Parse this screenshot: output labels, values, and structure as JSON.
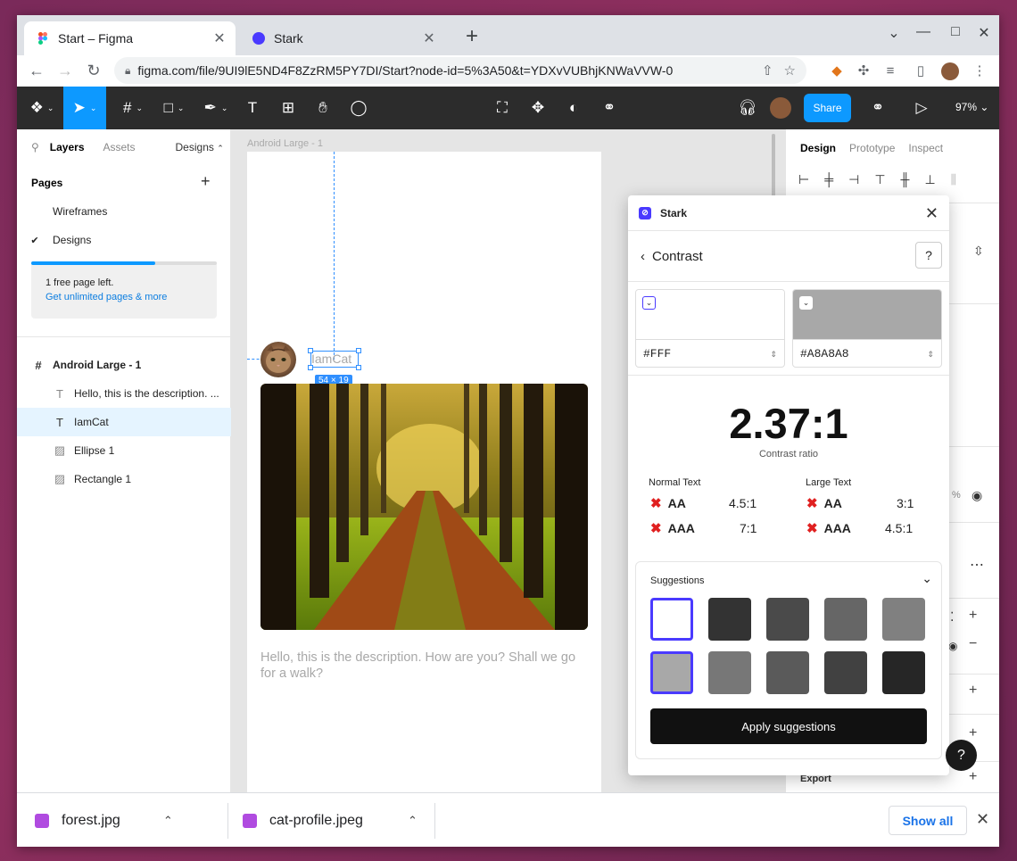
{
  "browser": {
    "tabs": [
      {
        "title": "Start – Figma",
        "active": true
      },
      {
        "title": "Stark",
        "active": false
      }
    ],
    "url": "figma.com/file/9UI9lE5ND4F8ZzRM5PY7DI/Start?node-id=5%3A50&t=YDXvVUBhjKNWaVVW-0"
  },
  "toolbar": {
    "share_label": "Share",
    "zoom_label": "97%"
  },
  "left_panel": {
    "tabs": [
      "Layers",
      "Assets"
    ],
    "page_dropdown": "Designs",
    "pages_heading": "Pages",
    "pages": [
      {
        "label": "Wireframes",
        "checked": false
      },
      {
        "label": "Designs",
        "checked": true
      }
    ],
    "upsell": {
      "text": "1 free page left.",
      "link": "Get unlimited pages & more",
      "progress": 0.67
    },
    "layers": [
      {
        "label": "Android Large - 1",
        "icon": "frame-icon",
        "bold": true
      },
      {
        "label": "Hello, this is the description. ...",
        "icon": "text-icon"
      },
      {
        "label": "IamCat",
        "icon": "text-icon",
        "selected": true
      },
      {
        "label": "Ellipse 1",
        "icon": "image-icon"
      },
      {
        "label": "Rectangle 1",
        "icon": "image-icon"
      }
    ]
  },
  "canvas": {
    "frame_label": "Android Large - 1",
    "selected_text": "IamCat",
    "dimension_badge": "54 × 19",
    "description": "Hello, this is the description. How are you? Shall we go for a walk?"
  },
  "right_panel": {
    "tabs": [
      "Design",
      "Prototype",
      "Inspect"
    ],
    "percent_fragment": "%",
    "export_label": "Export"
  },
  "stark": {
    "title": "Stark",
    "subtitle": "Contrast",
    "foreground": {
      "hex": "#FFF",
      "color": "#FFFFFF"
    },
    "background": {
      "hex": "#A8A8A8",
      "color": "#A8A8A8"
    },
    "ratio": "2.37:1",
    "ratio_caption": "Contrast ratio",
    "normal_text": {
      "heading": "Normal Text",
      "rows": [
        {
          "level": "AA",
          "target": "4.5:1",
          "pass": false
        },
        {
          "level": "AAA",
          "target": "7:1",
          "pass": false
        }
      ]
    },
    "large_text": {
      "heading": "Large Text",
      "rows": [
        {
          "level": "AA",
          "target": "3:1",
          "pass": false
        },
        {
          "level": "AAA",
          "target": "4.5:1",
          "pass": false
        }
      ]
    },
    "suggestions_heading": "Suggestions",
    "suggestions_row1": [
      "#FFFFFF",
      "#333333",
      "#4A4A4A",
      "#666666",
      "#808080"
    ],
    "suggestions_row2": [
      "#A8A8A8",
      "#777777",
      "#5A5A5A",
      "#414141",
      "#262626"
    ],
    "apply_label": "Apply suggestions",
    "accent": "#4A3AFF"
  },
  "downloads": {
    "items": [
      "forest.jpg",
      "cat-profile.jpeg"
    ],
    "show_all": "Show all"
  }
}
